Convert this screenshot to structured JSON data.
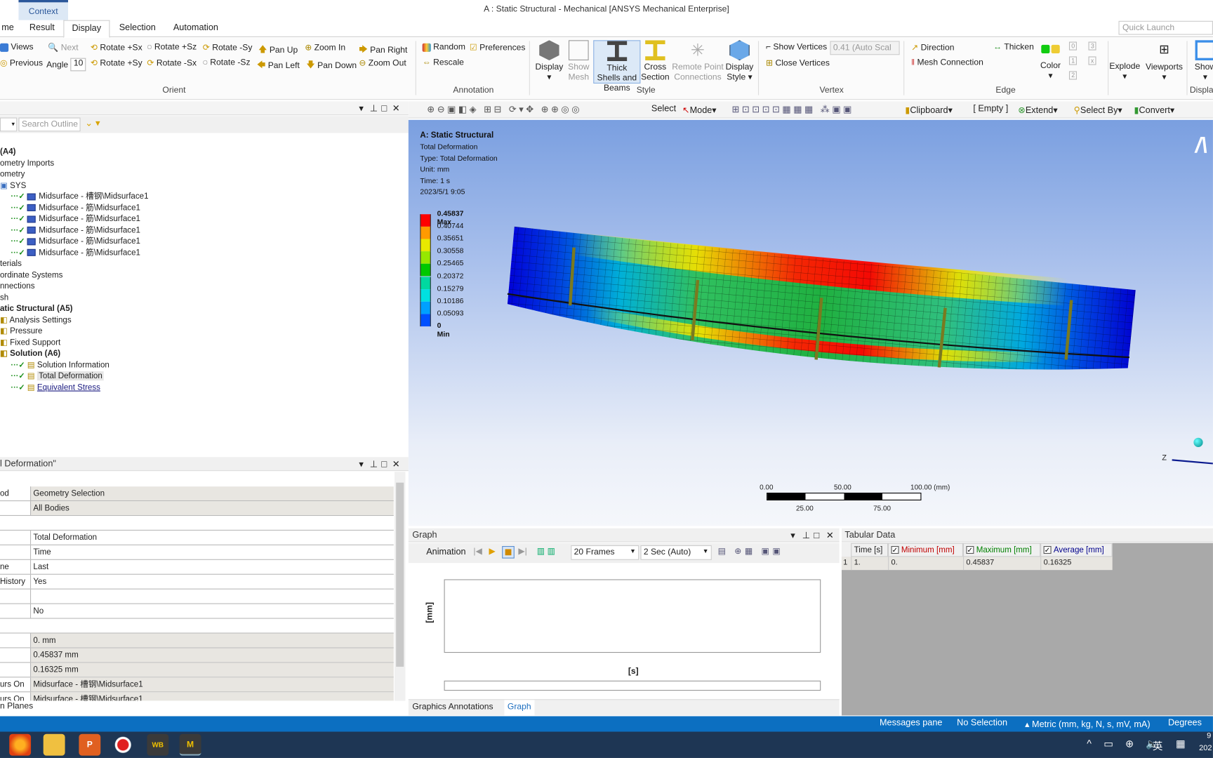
{
  "window": {
    "title": "A : Static Structural - Mechanical [ANSYS Mechanical Enterprise]",
    "context_tab": "Context",
    "quick_launch_placeholder": "Quick Launch"
  },
  "tabs": [
    {
      "label": "me"
    },
    {
      "label": "Result"
    },
    {
      "label": "Display",
      "active": true
    },
    {
      "label": "Selection"
    },
    {
      "label": "Automation"
    }
  ],
  "ribbon": {
    "orient": {
      "label": "Orient",
      "views": "Views",
      "next": "Next",
      "previous": "Previous",
      "angle_label": "Angle",
      "angle_value": "10",
      "rotate_px": "Rotate +Sx",
      "rotate_pz": "Rotate +Sz",
      "rotate_my": "Rotate -Sy",
      "rotate_py": "Rotate +Sy",
      "rotate_mx": "Rotate -Sx",
      "rotate_mz": "Rotate -Sz",
      "pan_up": "Pan Up",
      "pan_left": "Pan Left",
      "pan_down": "Pan Down",
      "pan_right": "Pan Right",
      "zoom_in": "Zoom In",
      "zoom_out": "Zoom Out"
    },
    "annotation": {
      "label": "Annotation",
      "random": "Random",
      "preferences": "Preferences",
      "rescale": "Rescale"
    },
    "style": {
      "label": "Style",
      "display": "Display",
      "show_mesh": "Show Mesh",
      "thick_shells": "Thick Shells and Beams",
      "cross_section": "Cross Section",
      "remote_point": "Remote Point Connections",
      "display_style": "Display Style"
    },
    "vertex": {
      "label": "Vertex",
      "show_vertices": "Show Vertices",
      "scale_value": "0.41 (Auto Scal",
      "close_vertices": "Close Vertices"
    },
    "edge": {
      "label": "Edge",
      "direction": "Direction",
      "thicken": "Thicken",
      "mesh_connection": "Mesh Connection",
      "color": "Color",
      "n0": "0",
      "n1": "1",
      "n2": "2",
      "n3": "3",
      "nx": "x"
    },
    "explode": "Explode",
    "viewports": "Viewports",
    "show": "Show",
    "display_group": "Displa"
  },
  "graphics_toolbar": {
    "select": "Select",
    "mode": "Mode",
    "clipboard": "Clipboard",
    "empty": "[ Empty ]",
    "extend": "Extend",
    "select_by": "Select By",
    "convert": "Convert"
  },
  "outline": {
    "search_placeholder": "Search Outline",
    "items": [
      {
        "label": "(A4)",
        "bold": true
      },
      {
        "label": "ometry Imports"
      },
      {
        "label": "ometry"
      },
      {
        "label": "SYS"
      },
      {
        "label": "Midsurface - 槽钢\\Midsurface1"
      },
      {
        "label": "Midsurface - 筋\\Midsurface1"
      },
      {
        "label": "Midsurface - 筋\\Midsurface1"
      },
      {
        "label": "Midsurface - 筋\\Midsurface1"
      },
      {
        "label": "Midsurface - 筋\\Midsurface1"
      },
      {
        "label": "Midsurface - 筋\\Midsurface1"
      },
      {
        "label": "terials"
      },
      {
        "label": "ordinate Systems"
      },
      {
        "label": "nnections"
      },
      {
        "label": "sh"
      },
      {
        "label": "atic Structural (A5)",
        "bold": true
      },
      {
        "label": "Analysis Settings"
      },
      {
        "label": "Pressure"
      },
      {
        "label": "Fixed Support"
      },
      {
        "label": "Solution (A6)",
        "bold": true
      },
      {
        "label": "Solution Information"
      },
      {
        "label": "Total Deformation",
        "selected": true
      },
      {
        "label": "Equivalent Stress",
        "hover": true
      }
    ]
  },
  "details": {
    "title": "l Deformation\"",
    "rows": [
      {
        "k": "od",
        "v": "Geometry Selection",
        "g": true
      },
      {
        "k": "",
        "v": "All Bodies",
        "g": true
      },
      {
        "k": "",
        "v": "",
        "section": true
      },
      {
        "k": "",
        "v": "Total Deformation"
      },
      {
        "k": "",
        "v": "Time"
      },
      {
        "k": "ne",
        "v": "Last"
      },
      {
        "k": "History",
        "v": "Yes"
      },
      {
        "k": "",
        "v": ""
      },
      {
        "k": "",
        "v": "No"
      },
      {
        "k": "",
        "v": "",
        "section": true
      },
      {
        "k": "",
        "v": "0. mm",
        "g": true
      },
      {
        "k": "",
        "v": "0.45837 mm",
        "g": true
      },
      {
        "k": "",
        "v": "0.16325 mm",
        "g": true
      },
      {
        "k": "urs On",
        "v": "Midsurface - 槽钢\\Midsurface1",
        "g": true
      },
      {
        "k": "urs On",
        "v": "Midsurface - 槽钢\\Midsurface1",
        "g": true
      }
    ],
    "footer": "n Planes"
  },
  "viewport": {
    "title": "A: Static Structural",
    "result": "Total Deformation",
    "type": "Type: Total Deformation",
    "unit": "Unit: mm",
    "time": "Time: 1 s",
    "date": "2023/5/1 9:05",
    "legend": [
      "0.45837 Max",
      "0.40744",
      "0.35651",
      "0.30558",
      "0.25465",
      "0.20372",
      "0.15279",
      "0.10186",
      "0.05093",
      "0 Min"
    ],
    "legend_colors": [
      "#ff0000",
      "#ff9a00",
      "#e8e800",
      "#96e800",
      "#00c800",
      "#00d8a0",
      "#00e0e0",
      "#00a0ff",
      "#0050ff",
      "#0000ff"
    ],
    "scale": {
      "t0": "0.00",
      "t50": "50.00",
      "t100": "100.00 (mm)",
      "t25": "25.00",
      "t75": "75.00"
    },
    "axis_label": "Z"
  },
  "graph": {
    "title": "Graph",
    "animation": "Animation",
    "frames": "20 Frames",
    "duration": "2 Sec (Auto)",
    "ylabel": "[mm]",
    "xlabel": "[s]"
  },
  "tabular": {
    "title": "Tabular Data",
    "headers": [
      "Time [s]",
      "Minimum [mm]",
      "Maximum [mm]",
      "Average [mm]"
    ],
    "header_colors": [
      "#222222",
      "#c00000",
      "#008000",
      "#00008b"
    ],
    "rows": [
      {
        "n": "1",
        "time": "1.",
        "min": "0.",
        "max": "0.45837",
        "avg": "0.16325"
      }
    ]
  },
  "bottom_tabs": {
    "annotations": "Graphics Annotations",
    "graph": "Graph"
  },
  "status": {
    "messages": "Messages pane",
    "selection": "No Selection",
    "units": "Metric (mm, kg, N, s, mV, mA)",
    "angle": "Degrees"
  },
  "taskbar": {
    "ime": "英",
    "wb": "WB",
    "m": "M",
    "clock1": "9",
    "clock2": "202"
  }
}
